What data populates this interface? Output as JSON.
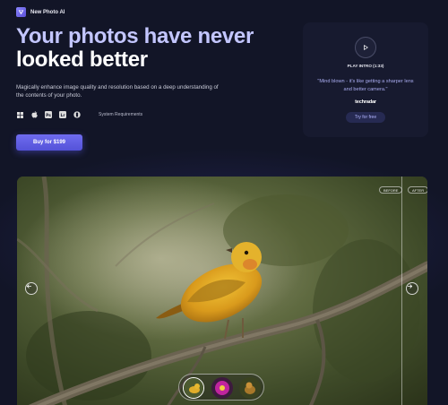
{
  "brand": {
    "name": "New Photo AI"
  },
  "hero": {
    "headline_line1": "Your photos have never",
    "headline_line2": "looked better",
    "description": "Magically enhance image quality and resolution based on a deep understanding of the contents of your photo.",
    "platform_icons": [
      "windows-icon",
      "apple-icon",
      "photoshop-icon",
      "lightroom-icon",
      "plugin-icon"
    ],
    "system_requirements": "System Requirements",
    "buy_label": "Buy for $199"
  },
  "intro_card": {
    "play_label": "PLAY INTRO (1:33)",
    "quote": "\"Mind blown - it's like getting a sharper lens and better camera.\"",
    "press_name": "techradar",
    "try_label": "Try for free"
  },
  "viewer": {
    "before_label": "BEFORE",
    "after_label": "AFTER",
    "thumbnails": [
      "bird-yellow",
      "flower-magenta",
      "bird-brown"
    ],
    "selected_thumbnail": 0
  },
  "colors": {
    "background": "#121527",
    "accent": "#6f6cf0",
    "headline_tint": "#c3c6ff",
    "quote": "#a9acf0"
  }
}
